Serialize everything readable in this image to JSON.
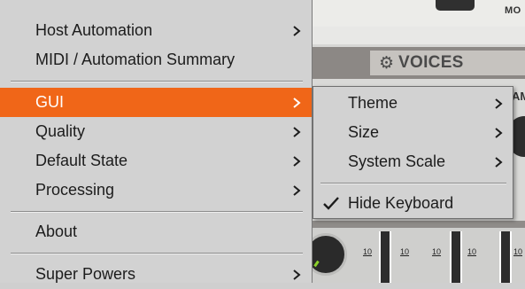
{
  "main_menu": {
    "items": [
      {
        "label": "Host Automation",
        "has_submenu": true
      },
      {
        "label": "MIDI / Automation Summary",
        "has_submenu": false
      },
      {
        "label": "GUI",
        "has_submenu": true,
        "active": true
      },
      {
        "label": "Quality",
        "has_submenu": true
      },
      {
        "label": "Default State",
        "has_submenu": true
      },
      {
        "label": "Processing",
        "has_submenu": true
      },
      {
        "label": "About",
        "has_submenu": false
      },
      {
        "label": "Super Powers",
        "has_submenu": true
      }
    ],
    "active_color": "#f06618"
  },
  "gui_submenu": {
    "items": [
      {
        "label": "Theme",
        "has_submenu": true
      },
      {
        "label": "Size",
        "has_submenu": true
      },
      {
        "label": "System Scale",
        "has_submenu": true
      },
      {
        "label": "Hide Keyboard",
        "checked": true
      }
    ]
  },
  "background": {
    "voices_label": "VOICES",
    "top_label": "MO",
    "right_label": "AM",
    "fader_label_1": "10",
    "fader_label_2": "10",
    "fader_label_3": "10",
    "fader_label_4": "10"
  },
  "icons": {
    "submenu_arrow": "chevron-right-icon",
    "check": "check-icon",
    "voices": "gear-icon"
  }
}
